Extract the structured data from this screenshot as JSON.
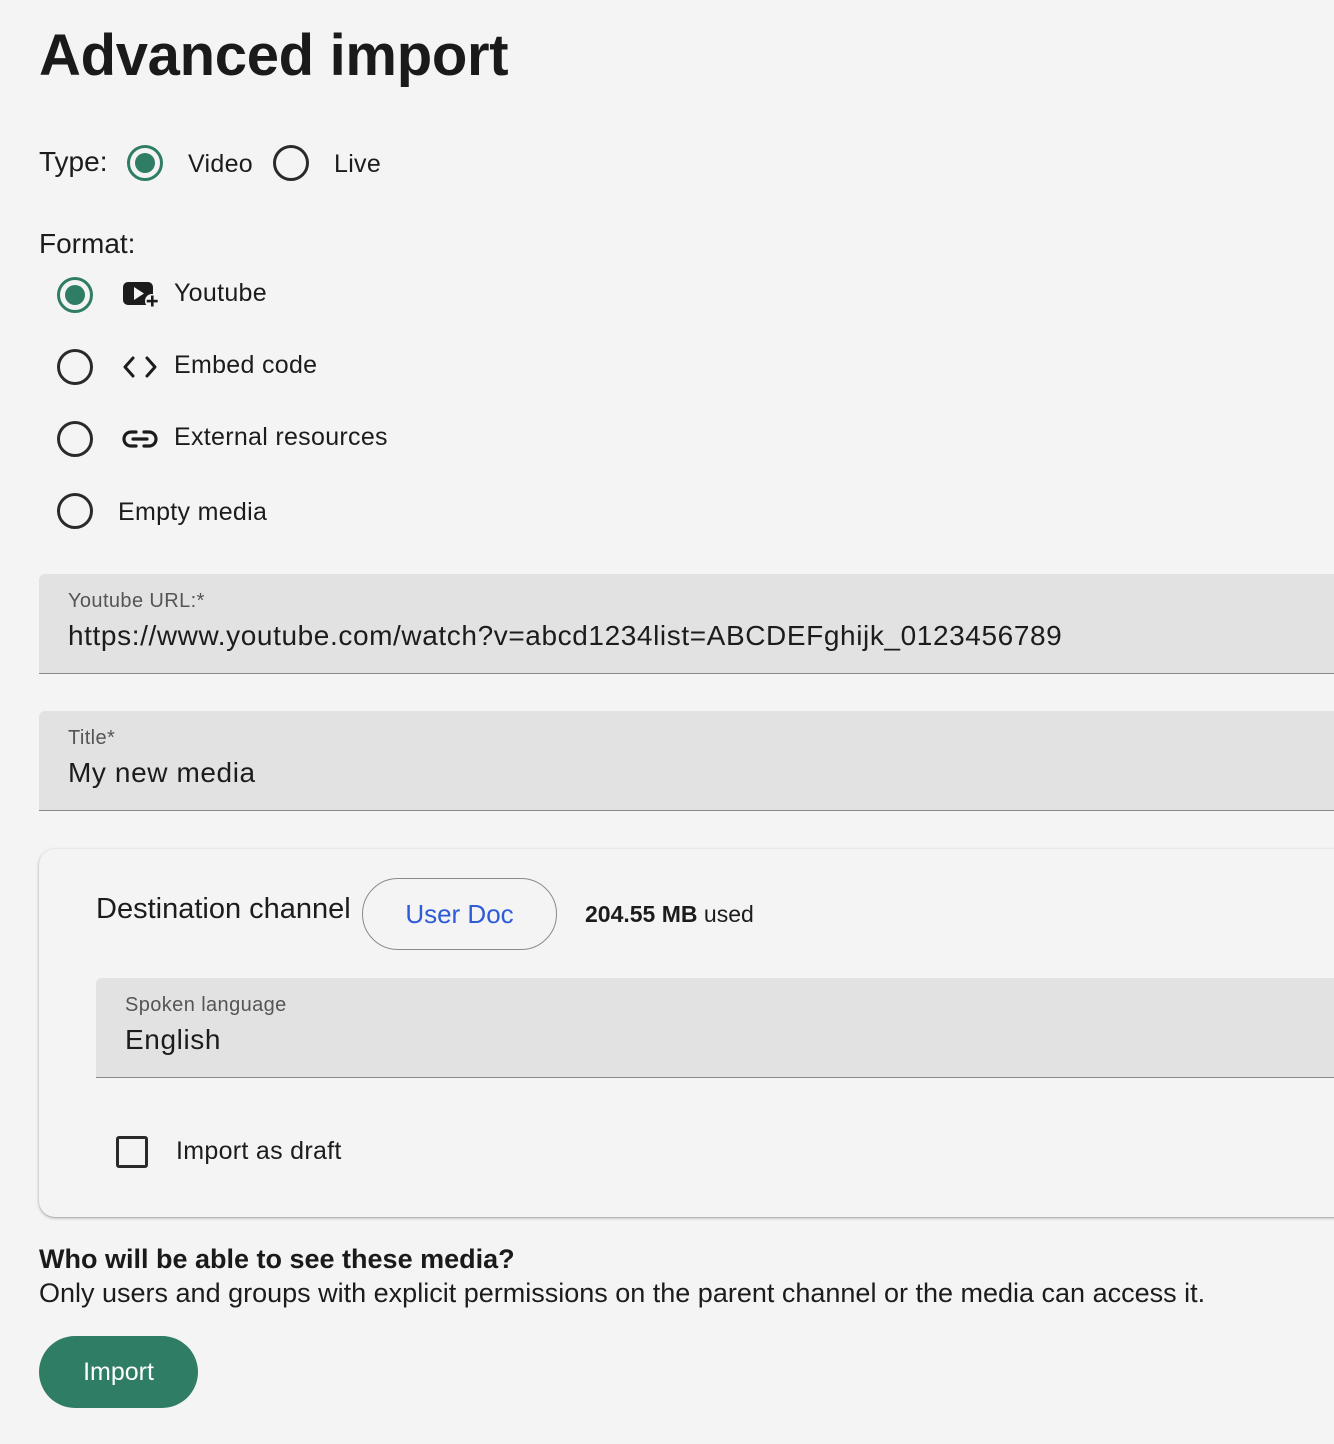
{
  "page": {
    "title": "Advanced import"
  },
  "type": {
    "label": "Type:",
    "options": [
      {
        "label": "Video",
        "selected": true
      },
      {
        "label": "Live",
        "selected": false
      }
    ]
  },
  "format": {
    "label": "Format:",
    "options": [
      {
        "label": "Youtube",
        "icon": "youtube-add-icon",
        "selected": true
      },
      {
        "label": "Embed code",
        "icon": "code-brackets-icon",
        "selected": false
      },
      {
        "label": "External resources",
        "icon": "link-icon",
        "selected": false
      },
      {
        "label": "Empty media",
        "icon": "",
        "selected": false
      }
    ]
  },
  "youtube_url": {
    "label": "Youtube URL:*",
    "value": "https://www.youtube.com/watch?v=abcd1234list=ABCDEFghijk_0123456789"
  },
  "title_field": {
    "label": "Title*",
    "value": "My new media"
  },
  "destination": {
    "label": "Destination channel",
    "channel": "User Doc",
    "usage_amount": "204.55 MB",
    "usage_suffix": "used"
  },
  "language": {
    "label": "Spoken language",
    "value": "English"
  },
  "draft": {
    "label": "Import as draft",
    "checked": false
  },
  "visibility": {
    "heading": "Who will be able to see these media?",
    "description": "Only users and groups with explicit permissions on the parent channel or the media can access it."
  },
  "actions": {
    "import_label": "Import"
  },
  "colors": {
    "accent": "#2f7d64",
    "link": "#2e5bd6",
    "background": "#f4f4f4",
    "field_background": "#e2e2e2"
  }
}
